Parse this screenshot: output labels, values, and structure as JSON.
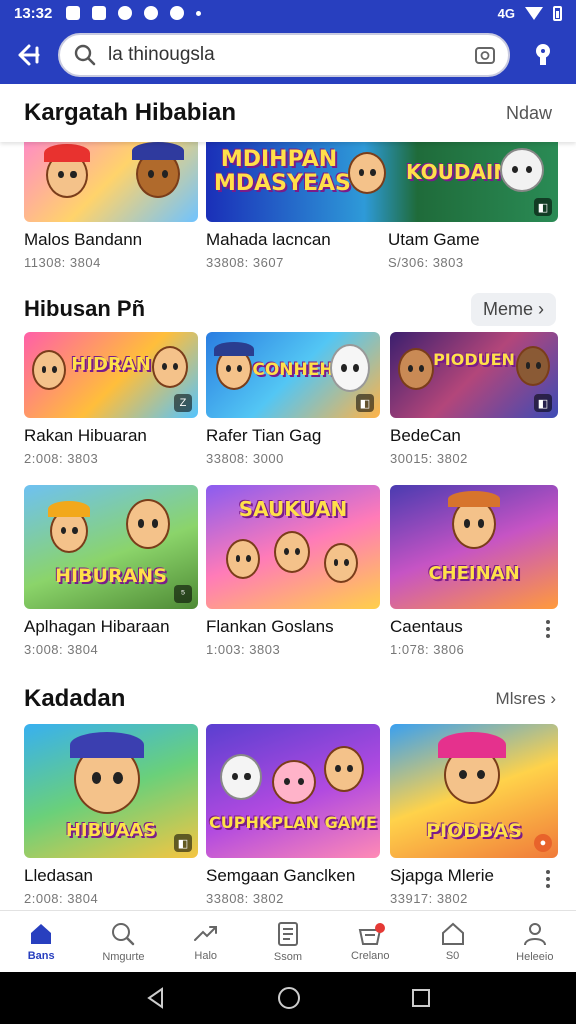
{
  "status_bar": {
    "time": "13:32",
    "network": "4G"
  },
  "search": {
    "placeholder": "la thinougsla",
    "value": "la thinougsla"
  },
  "sections": [
    {
      "title": "Kargatah Hibabian",
      "action": "Ndaw",
      "cards": [
        {
          "name": "Malos Bandann",
          "meta": "11308: 3804"
        },
        {
          "name": "Mahada lacncan",
          "meta": "33808: 3607",
          "banner": "MDIHPAN MDASYEAS"
        },
        {
          "name": "Utam Game",
          "meta": "S/306: 3803",
          "banner": "KOUDAIN"
        }
      ]
    },
    {
      "title": "Hibusan Pñ",
      "action": "Meme",
      "cards": [
        {
          "name": "Rakan Hibuaran",
          "meta": "2:008: 3803",
          "banner": "HIDRAN"
        },
        {
          "name": "Rafer Tian Gag",
          "meta": "33808: 3000",
          "banner": "CONHEH"
        },
        {
          "name": "BedeCan",
          "meta": "30015: 3802",
          "banner": "PIODUEN"
        },
        {
          "name": "Aplhagan Hibaraan",
          "meta": "3:008: 3804",
          "banner": "HIBURANS"
        },
        {
          "name": "Flankan Goslans",
          "meta": "1:003: 3803",
          "banner": "SAUKUAN"
        },
        {
          "name": "Caentaus",
          "meta": "1:078: 3806",
          "banner": "CHEINAN"
        }
      ]
    },
    {
      "title": "Kadadan",
      "action": "Mlsres",
      "cards": [
        {
          "name": "Lledasan",
          "meta": "2:008: 3804",
          "banner": "HIBUAAS"
        },
        {
          "name": "Semgaan Ganclken",
          "meta": "33808: 3802",
          "banner": "CUPHKPLAN GAME"
        },
        {
          "name": "Sjapga Mlerie",
          "meta": "33917: 3802",
          "banner": "PIODBAS"
        }
      ]
    }
  ],
  "bottom_nav": [
    {
      "label": "Bans",
      "icon": "home-icon",
      "active": true
    },
    {
      "label": "Nmgurte",
      "icon": "search-icon"
    },
    {
      "label": "Halo",
      "icon": "arrow-icon"
    },
    {
      "label": "Ssom",
      "icon": "list-icon"
    },
    {
      "label": "Crelano",
      "icon": "inbox-icon"
    },
    {
      "label": "S0",
      "icon": "house-outline-icon"
    },
    {
      "label": "Heleeio",
      "icon": "profile-icon"
    }
  ],
  "colors": {
    "brand": "#283fbf",
    "accent_text": "#ffe04a"
  }
}
